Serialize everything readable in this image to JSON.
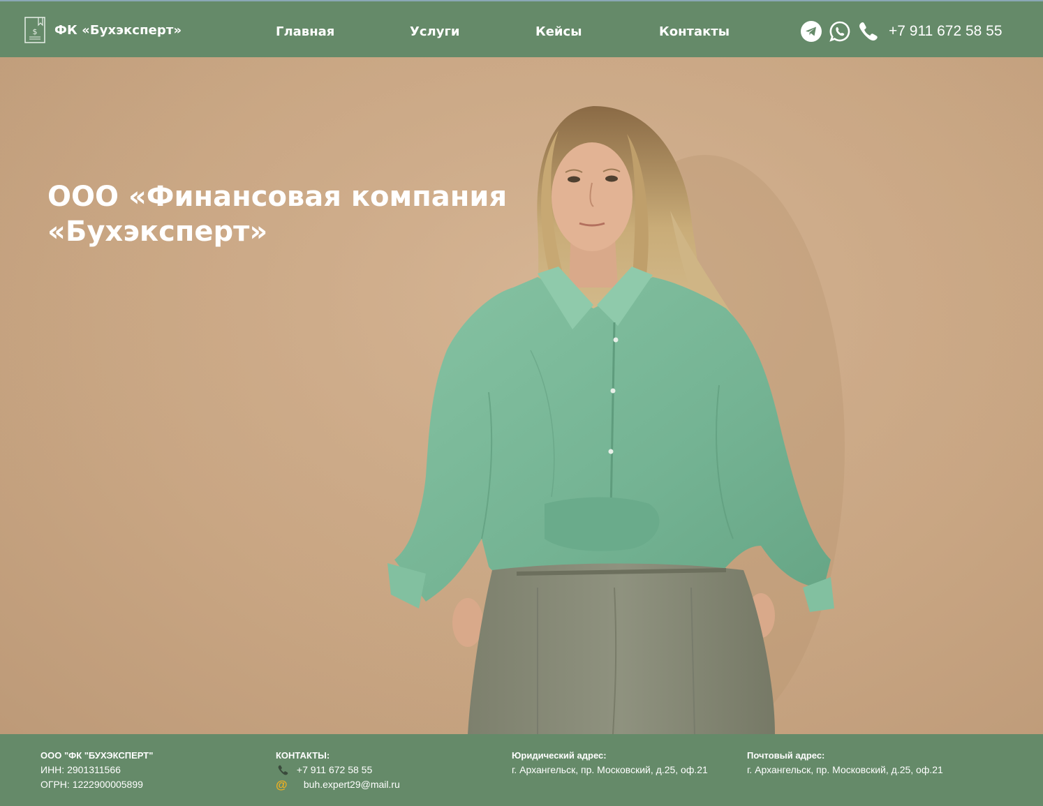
{
  "header": {
    "brand": "ФК «Бухэксперт»",
    "nav": [
      "Главная",
      "Услуги",
      "Кейсы",
      "Контакты"
    ],
    "phone": "+7 911 672 58 55",
    "icons": [
      "document-dollar-icon",
      "telegram-icon",
      "whatsapp-icon",
      "phone-icon"
    ]
  },
  "hero": {
    "title_line1": "ООО «Финансовая компания",
    "title_line2": "«Бухэксперт»"
  },
  "footer": {
    "company": {
      "name": "ООО \"ФК \"БУХЭКСПЕРТ\"",
      "inn": "ИНН: 2901311566",
      "ogrn": "ОГРН: 1222900005899"
    },
    "contacts": {
      "heading": "КОНТАКТЫ:",
      "phone": "+7 911 672 58 55",
      "at_symbol": "@",
      "email": "buh.expert29@mail.ru"
    },
    "legal_address": {
      "heading": "Юридический адрес:",
      "text": "г. Архангельск, пр. Московский, д.25, оф.21"
    },
    "postal_address": {
      "heading": "Почтовый адрес:",
      "text": "г. Архангельск, пр. Московский, д.25, оф.21"
    }
  },
  "colors": {
    "header_bg": "#658a69",
    "footer_bg": "#658a69",
    "wall": "#cba885",
    "shirt": "#7cba9a",
    "pants": "#878a76",
    "email_icon": "#f0b020"
  }
}
